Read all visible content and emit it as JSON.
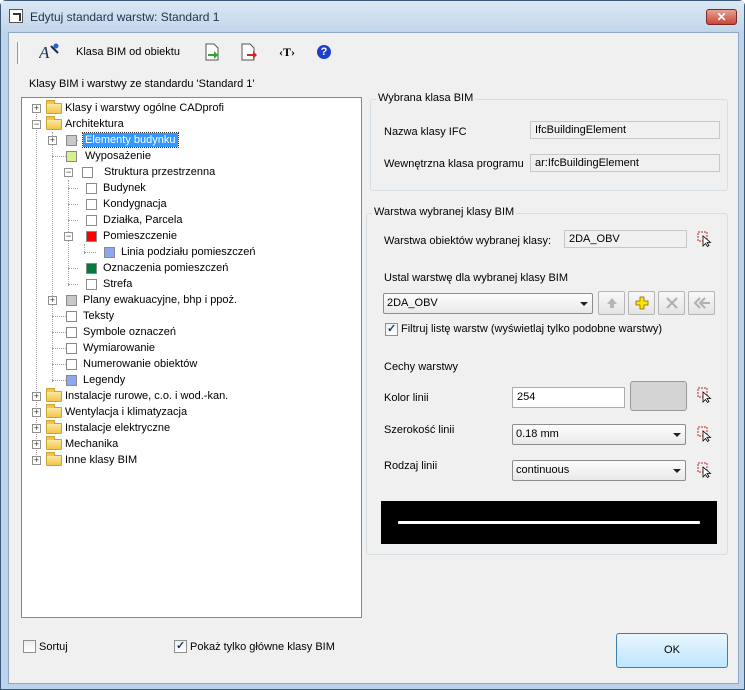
{
  "window": {
    "title": "Edytuj standard warstw: Standard 1",
    "close_glyph": "✕"
  },
  "toolbar": {
    "bim_from_object_label": "Klasa BIM od obiektu",
    "text_tool_label": "‹T›",
    "help_label": "?"
  },
  "tree": {
    "header": "Klasy BIM i warstwy ze standardu 'Standard 1'",
    "items": [
      {
        "label": "Klasy i warstwy ogólne CADprofi"
      },
      {
        "label": "Architektura"
      },
      {
        "label": "Elementy budynku",
        "color": "#c8c8c8",
        "selected": true
      },
      {
        "label": "Wyposażenie",
        "color": "#d6f28a"
      },
      {
        "label": "Struktura przestrzenna",
        "color": "#ffffff"
      },
      {
        "label": "Budynek",
        "color": "#ffffff"
      },
      {
        "label": "Kondygnacja",
        "color": "#ffffff"
      },
      {
        "label": "Działka, Parcela",
        "color": "#ffffff"
      },
      {
        "label": "Pomieszczenie",
        "color": "#ff0000"
      },
      {
        "label": "Linia podziału pomieszczeń",
        "color": "#8da6f0"
      },
      {
        "label": "Oznaczenia pomieszczeń",
        "color": "#007a3d"
      },
      {
        "label": "Strefa",
        "color": "#ffffff"
      },
      {
        "label": "Plany ewakuacyjne, bhp i ppoż.",
        "color": "#c8c8c8"
      },
      {
        "label": "Teksty",
        "color": "#ffffff"
      },
      {
        "label": "Symbole oznaczeń",
        "color": "#ffffff"
      },
      {
        "label": "Wymiarowanie",
        "color": "#ffffff"
      },
      {
        "label": "Numerowanie obiektów",
        "color": "#ffffff"
      },
      {
        "label": "Legendy",
        "color": "#8da6f0"
      },
      {
        "label": "Instalacje rurowe, c.o. i wod.-kan."
      },
      {
        "label": "Wentylacja i klimatyzacja"
      },
      {
        "label": "Instalacje elektryczne"
      },
      {
        "label": "Mechanika"
      },
      {
        "label": "Inne klasy BIM"
      }
    ],
    "expand_plus": "+",
    "expand_minus": "−"
  },
  "bim_class": {
    "group_title": "Wybrana klasa BIM",
    "ifc_label": "Nazwa klasy IFC",
    "ifc_value": "IfcBuildingElement",
    "internal_label": "Wewnętrzna klasa programu",
    "internal_value": "ar:IfcBuildingElement"
  },
  "layer": {
    "group_title": "Warstwa wybranej klasy BIM",
    "objects_layer_label": "Warstwa obiektów wybranej klasy:",
    "objects_layer_value": "2DA_OBV",
    "set_layer_label": "Ustal warstwę dla wybranej klasy BIM",
    "set_layer_value": "2DA_OBV",
    "filter_label": "Filtruj listę warstw (wyświetlaj tylko podobne warstwy)",
    "filter_checked": true,
    "features_label": "Cechy warstwy",
    "color_label": "Kolor linii",
    "color_value": "254",
    "color_swatch": "#d4d4d4",
    "width_label": "Szerokość linii",
    "width_value": "0.18 mm",
    "type_label": "Rodzaj linii",
    "type_value": "continuous",
    "preview_bg": "#000000",
    "preview_line": "#ffffff"
  },
  "footer": {
    "sort_label": "Sortuj",
    "sort_checked": false,
    "main_only_label": "Pokaż tylko główne klasy BIM",
    "main_only_checked": true,
    "ok_label": "OK"
  }
}
